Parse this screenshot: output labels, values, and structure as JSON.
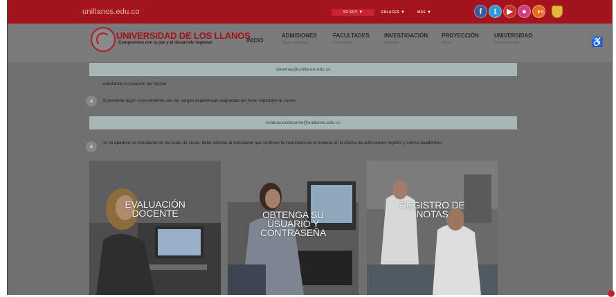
{
  "site": {
    "domain": "unillanos.edu.co"
  },
  "topbar": {
    "yo_soy": "YO SOY",
    "enlaces": "ENLACES",
    "mas": "MÁS",
    "social": [
      {
        "icon": "facebook-icon",
        "glyph": "f",
        "color": "#3b5998"
      },
      {
        "icon": "twitter-icon",
        "glyph": "t",
        "color": "#2f9bd6"
      },
      {
        "icon": "youtube-icon",
        "glyph": "▶",
        "color": "#c4302b"
      },
      {
        "icon": "flickr-icon",
        "glyph": "●",
        "color": "#d03d7f"
      },
      {
        "icon": "rss-icon",
        "glyph": "◗",
        "color": "#e86a1c"
      }
    ]
  },
  "header": {
    "brand_name": "UNIVERSIDAD DE LOS LLANOS",
    "brand_slogan": "Compromiso con la paz y el desarrollo regional",
    "nav": [
      {
        "label": "INICIO",
        "sub": ""
      },
      {
        "label": "ADMISIONES",
        "sub": "Únete a nosotros"
      },
      {
        "label": "FACULTADES",
        "sub": "y programas"
      },
      {
        "label": "INVESTIGACIÓN",
        "sub": "Dirección"
      },
      {
        "label": "PROYECCIÓN",
        "sub": "Social"
      },
      {
        "label": "UNIVERSIDAD",
        "sub": "Quiénes Somos"
      }
    ]
  },
  "content": {
    "email1": "sistemas@unillanos.edu.co",
    "text1": "solicitando la creación del mismo",
    "step4_number": "4",
    "step4_text": "Si presenta algún inconveniente con las cargas académicas asignadas por favor reportarlo al correo",
    "email2": "evaluaciondocente@unillanos.edu.co",
    "step5_number": "5",
    "step5_text": "Si no aparece un estudiante en las listas de curso, debe solicitar al estudiante que verifique la inscripción de la materia en la oficina de admisiones registro y control académico"
  },
  "cards": [
    {
      "line1": "EVALUACIÓN",
      "line2": "DOCENTE",
      "line3": ""
    },
    {
      "line1": "OBTENGA SU",
      "line2": "USUARIO Y",
      "line3": "CONTRASEÑA"
    },
    {
      "line1": "REGISTRO DE",
      "line2": "NOTAS",
      "line3": ""
    }
  ],
  "colors": {
    "brand_red": "#a3141c",
    "email_box": "#a9b6b8"
  }
}
